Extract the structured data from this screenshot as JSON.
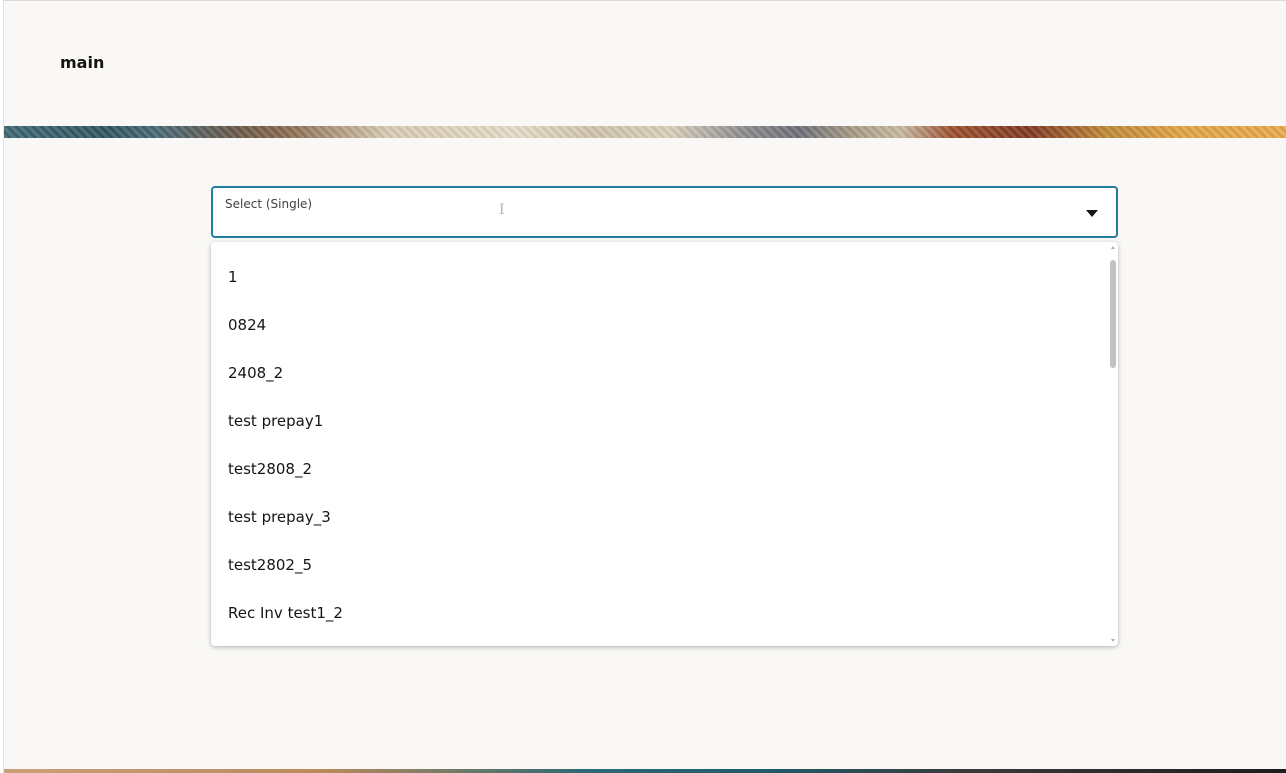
{
  "header": {
    "title": "main"
  },
  "select": {
    "label": "Select (Single)",
    "value": "",
    "cursor_glyph": "I"
  },
  "dropdown": {
    "options": [
      {
        "label": "1"
      },
      {
        "label": "0824"
      },
      {
        "label": "2408_2"
      },
      {
        "label": "test prepay1"
      },
      {
        "label": "test2808_2"
      },
      {
        "label": "test prepay_3"
      },
      {
        "label": "test2802_5"
      },
      {
        "label": "Rec Inv test1_2"
      }
    ]
  },
  "icons": {
    "dropdown_arrow": "caret-down-icon",
    "scroll_up": "scroll-up-arrow-icon",
    "scroll_down": "scroll-down-arrow-icon"
  },
  "colors": {
    "focus_border": "#227e9e",
    "page_background": "#f9f8f6",
    "text": "#161513"
  }
}
